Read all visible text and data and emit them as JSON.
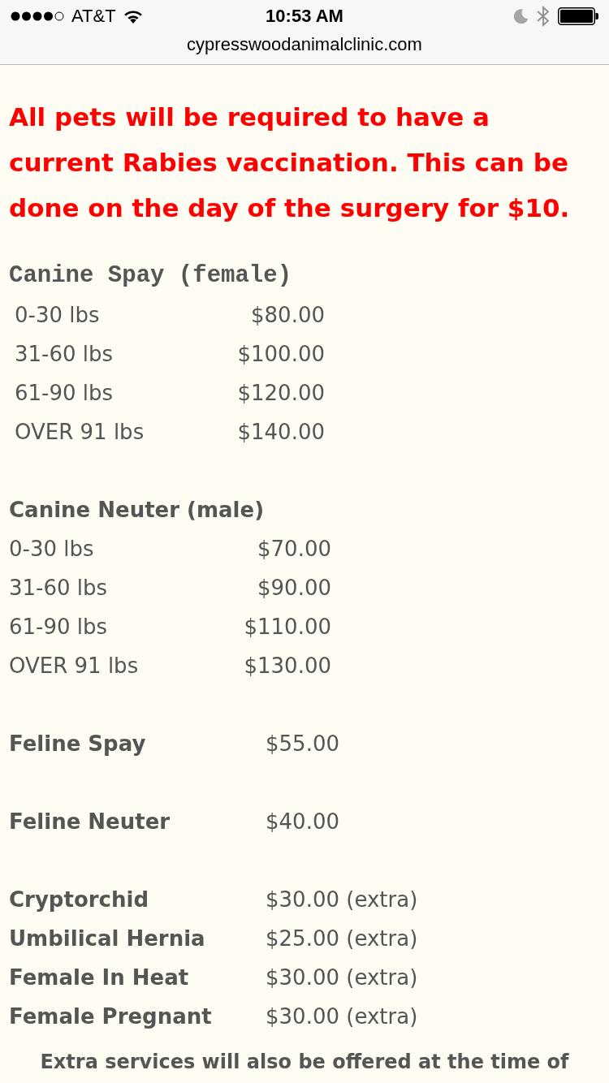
{
  "status_bar": {
    "carrier": "AT&T",
    "time": "10:53 AM"
  },
  "address_bar": {
    "url": "cypresswoodanimalclinic.com"
  },
  "notice": "All pets will be required to have a current Rabies vaccination. This can be done on the day of the surgery for $10.",
  "price_groups": [
    {
      "kind": "table",
      "title": "Canine Spay (female)",
      "rows": [
        {
          "label": "0-30 lbs",
          "price": "$80.00"
        },
        {
          "label": "31-60 lbs",
          "price": "$100.00"
        },
        {
          "label": "61-90 lbs",
          "price": "$120.00"
        },
        {
          "label": "OVER 91 lbs",
          "price": "$140.00"
        }
      ]
    },
    {
      "kind": "list",
      "title": "Canine Neuter (male)",
      "rows": [
        {
          "label": "0-30 lbs",
          "price": "$70.00"
        },
        {
          "label": "31-60 lbs",
          "price": "$90.00"
        },
        {
          "label": "61-90 lbs",
          "price": "$110.00"
        },
        {
          "label": "OVER 91 lbs",
          "price": "$130.00"
        }
      ]
    },
    {
      "kind": "item",
      "label": "Feline Spay",
      "price": "$55.00"
    },
    {
      "kind": "item",
      "label": "Feline Neuter",
      "price": "$40.00"
    },
    {
      "kind": "extras",
      "rows": [
        {
          "label": "Cryptorchid",
          "price": "$30.00 (extra)"
        },
        {
          "label": "Umbilical Hernia",
          "price": "$25.00 (extra)"
        },
        {
          "label": "Female In Heat",
          "price": "$30.00 (extra)"
        },
        {
          "label": "Female Pregnant",
          "price": "$30.00 (extra)"
        }
      ]
    }
  ],
  "footer_note": "Extra services will also be offered at the time of"
}
